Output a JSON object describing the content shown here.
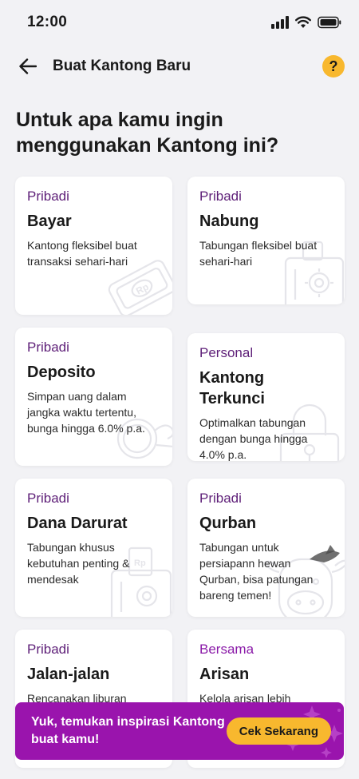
{
  "status_bar": {
    "time": "12:00"
  },
  "header": {
    "title": "Buat Kantong Baru",
    "help_label": "?"
  },
  "question": "Untuk apa kamu ingin menggunakan Kantong ini?",
  "cards": [
    {
      "type": "Pribadi",
      "title": "Bayar",
      "desc": "Kantong fleksibel buat transaksi sehari-hari",
      "icon": "wallet-rp-icon"
    },
    {
      "type": "Pribadi",
      "title": "Nabung",
      "desc": "Tabungan fleksibel buat sehari-hari",
      "icon": "safe-icon"
    },
    {
      "type": "Pribadi",
      "title": "Deposito",
      "desc": "Simpan uang dalam jangka waktu tertentu, bunga hingga 6.0% p.a.",
      "icon": "coin-hand-icon"
    },
    {
      "type": "Personal",
      "title": "Kantong Terkunci",
      "desc": "Optimalkan tabungan dengan bunga hingga 4.0% p.a.",
      "icon": "lock-icon"
    },
    {
      "type": "Pribadi",
      "title": "Dana Darurat",
      "desc": "Tabungan khusus kebutuhan penting & mendesak",
      "icon": "safe-icon"
    },
    {
      "type": "Pribadi",
      "title": "Qurban",
      "desc": "Tabungan untuk persiapann hewan Qurban, bisa patungan bareng temen!",
      "icon": "cow-icon"
    },
    {
      "type": "Pribadi",
      "title": "Jalan-jalan",
      "desc": "Rencanakan liburan",
      "icon": "travel-icon"
    },
    {
      "type": "Bersama",
      "title": "Arisan",
      "desc": "Kelola arisan lebih",
      "icon": "group-icon"
    }
  ],
  "banner": {
    "text": "Yuk, temukan inspirasi Kantong buat kamu!",
    "button": "Cek Sekarang"
  },
  "colors": {
    "purple_text": "#5e1f78",
    "bersama_text": "#8a1aa8",
    "banner_bg": "#9a14ad",
    "accent_yellow": "#f8b82e"
  }
}
